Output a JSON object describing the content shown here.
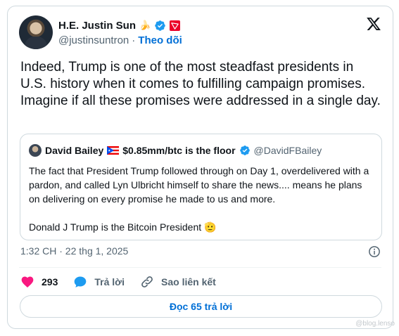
{
  "author": {
    "display_name": "H.E. Justin Sun",
    "handle": "@justinsuntron",
    "separator": "·",
    "follow_label": "Theo dõi"
  },
  "tweet": {
    "text": "Indeed, Trump is one of the most steadfast presidents in U.S. history when it comes to fulfilling campaign promises. Imagine if all these promises were addressed in a single day."
  },
  "quote": {
    "display_name": "David Bailey",
    "name_suffix": "$0.85mm/btc is the floor",
    "handle": "@DavidFBailey",
    "paragraph1": "The fact that President Trump followed through on Day 1, overdelivered with a pardon, and called Lyn Ulbricht himself to share the news.... means he plans on delivering on every promise he made to us and more.",
    "paragraph2": "Donald J Trump is the Bitcoin President 🫡"
  },
  "meta": {
    "timestamp": "1:32 CH · 22 thg 1, 2025"
  },
  "actions": {
    "like_count": "293",
    "reply_label": "Trả lời",
    "copy_link_label": "Sao liên kết"
  },
  "read_replies_label": "Đọc 65 trả lời",
  "watermark": "@blog.lenso",
  "colors": {
    "link_blue": "#006fd6",
    "like_red": "#f91880",
    "verified_blue": "#1d9bf0",
    "border": "#cfd9de",
    "secondary_text": "#536471"
  },
  "icons": {
    "brand": "x-logo-icon",
    "verified": "verified-badge-icon",
    "like": "heart-icon",
    "reply": "reply-bubble-icon",
    "link": "link-icon",
    "info": "info-icon"
  }
}
